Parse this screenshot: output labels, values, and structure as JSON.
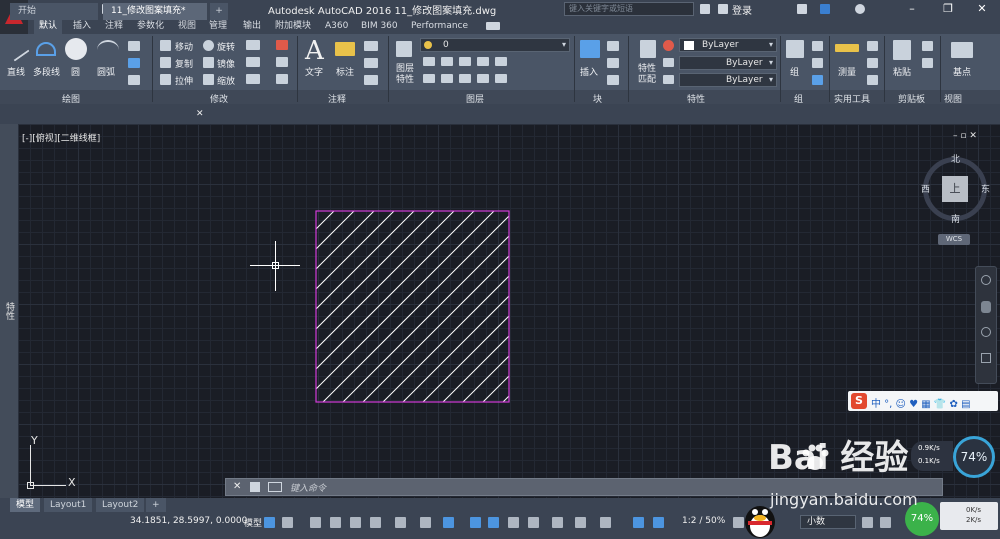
{
  "title_bar": {
    "title": "Autodesk AutoCAD 2016    11_修改图案填充.dwg",
    "search_placeholder": "键入关键字或短语",
    "login_label": "登录"
  },
  "ribbon_tabs": [
    "默认",
    "插入",
    "注释",
    "参数化",
    "视图",
    "管理",
    "输出",
    "附加模块",
    "A360",
    "BIM 360",
    "Performance"
  ],
  "ribbon": {
    "draw": {
      "title": "绘图",
      "line": "直线",
      "polyline": "多段线",
      "circle": "圆",
      "arc": "圆弧"
    },
    "modify": {
      "title": "修改",
      "move": "移动",
      "rotate": "旋转",
      "copy": "复制",
      "mirror": "镜像",
      "stretch": "拉伸",
      "scale": "缩放"
    },
    "annotation": {
      "title": "注释",
      "text": "文字",
      "dimension": "标注"
    },
    "layers": {
      "title": "图层",
      "layer_properties": "图层\n特性",
      "current_layer": "0"
    },
    "block": {
      "title": "块",
      "insert": "插入"
    },
    "properties": {
      "title": "特性",
      "match": "特性\n匹配",
      "color": "ByLayer",
      "linetype": "ByLayer",
      "lineweight": "ByLayer"
    },
    "groups": {
      "title": "组",
      "group": "组"
    },
    "utilities": {
      "title": "实用工具",
      "measure": "测量"
    },
    "clipboard": {
      "title": "剪贴板",
      "paste": "粘贴"
    },
    "view": {
      "title": "视图",
      "base": "基点"
    }
  },
  "doc_tabs": [
    {
      "label": "开始"
    },
    {
      "label": "11_修改图案填充*"
    }
  ],
  "sidebar_label": "特性",
  "viewport": {
    "view_label": "[-][俯视][二维线框]",
    "viewcube": {
      "top_face": "上",
      "north": "北",
      "south": "南",
      "east": "东",
      "west": "西",
      "wcs": "WCS"
    },
    "ucs": {
      "x": "X",
      "y": "Y"
    }
  },
  "command_line": {
    "placeholder": "键入命令"
  },
  "layout_tabs": [
    "模型",
    "Layout1",
    "Layout2"
  ],
  "status_bar": {
    "coordinates": "34.1851, 28.5997, 0.0000",
    "model_label": "模型",
    "scale": "1:2 / 50%",
    "units": "小数"
  },
  "overlays": {
    "sogou": {
      "text": "中 °, ☺ ♥ ▦ 👕 ✿ ▤"
    },
    "net_speed": {
      "upload": "0.9K/s",
      "download": "0.1K/s",
      "cpu": "74%"
    },
    "net_speed2": {
      "cpu": "74%",
      "upload": "0K/s",
      "download": "2K/s"
    },
    "watermark": {
      "brand": "Bai  经验",
      "url": "jingyan.baidu.com"
    }
  },
  "colors": {
    "canvas": "#1a1d25",
    "hatch": "#ffffff",
    "boundary": "#d13bd8",
    "ribbon": "#4a5566"
  }
}
